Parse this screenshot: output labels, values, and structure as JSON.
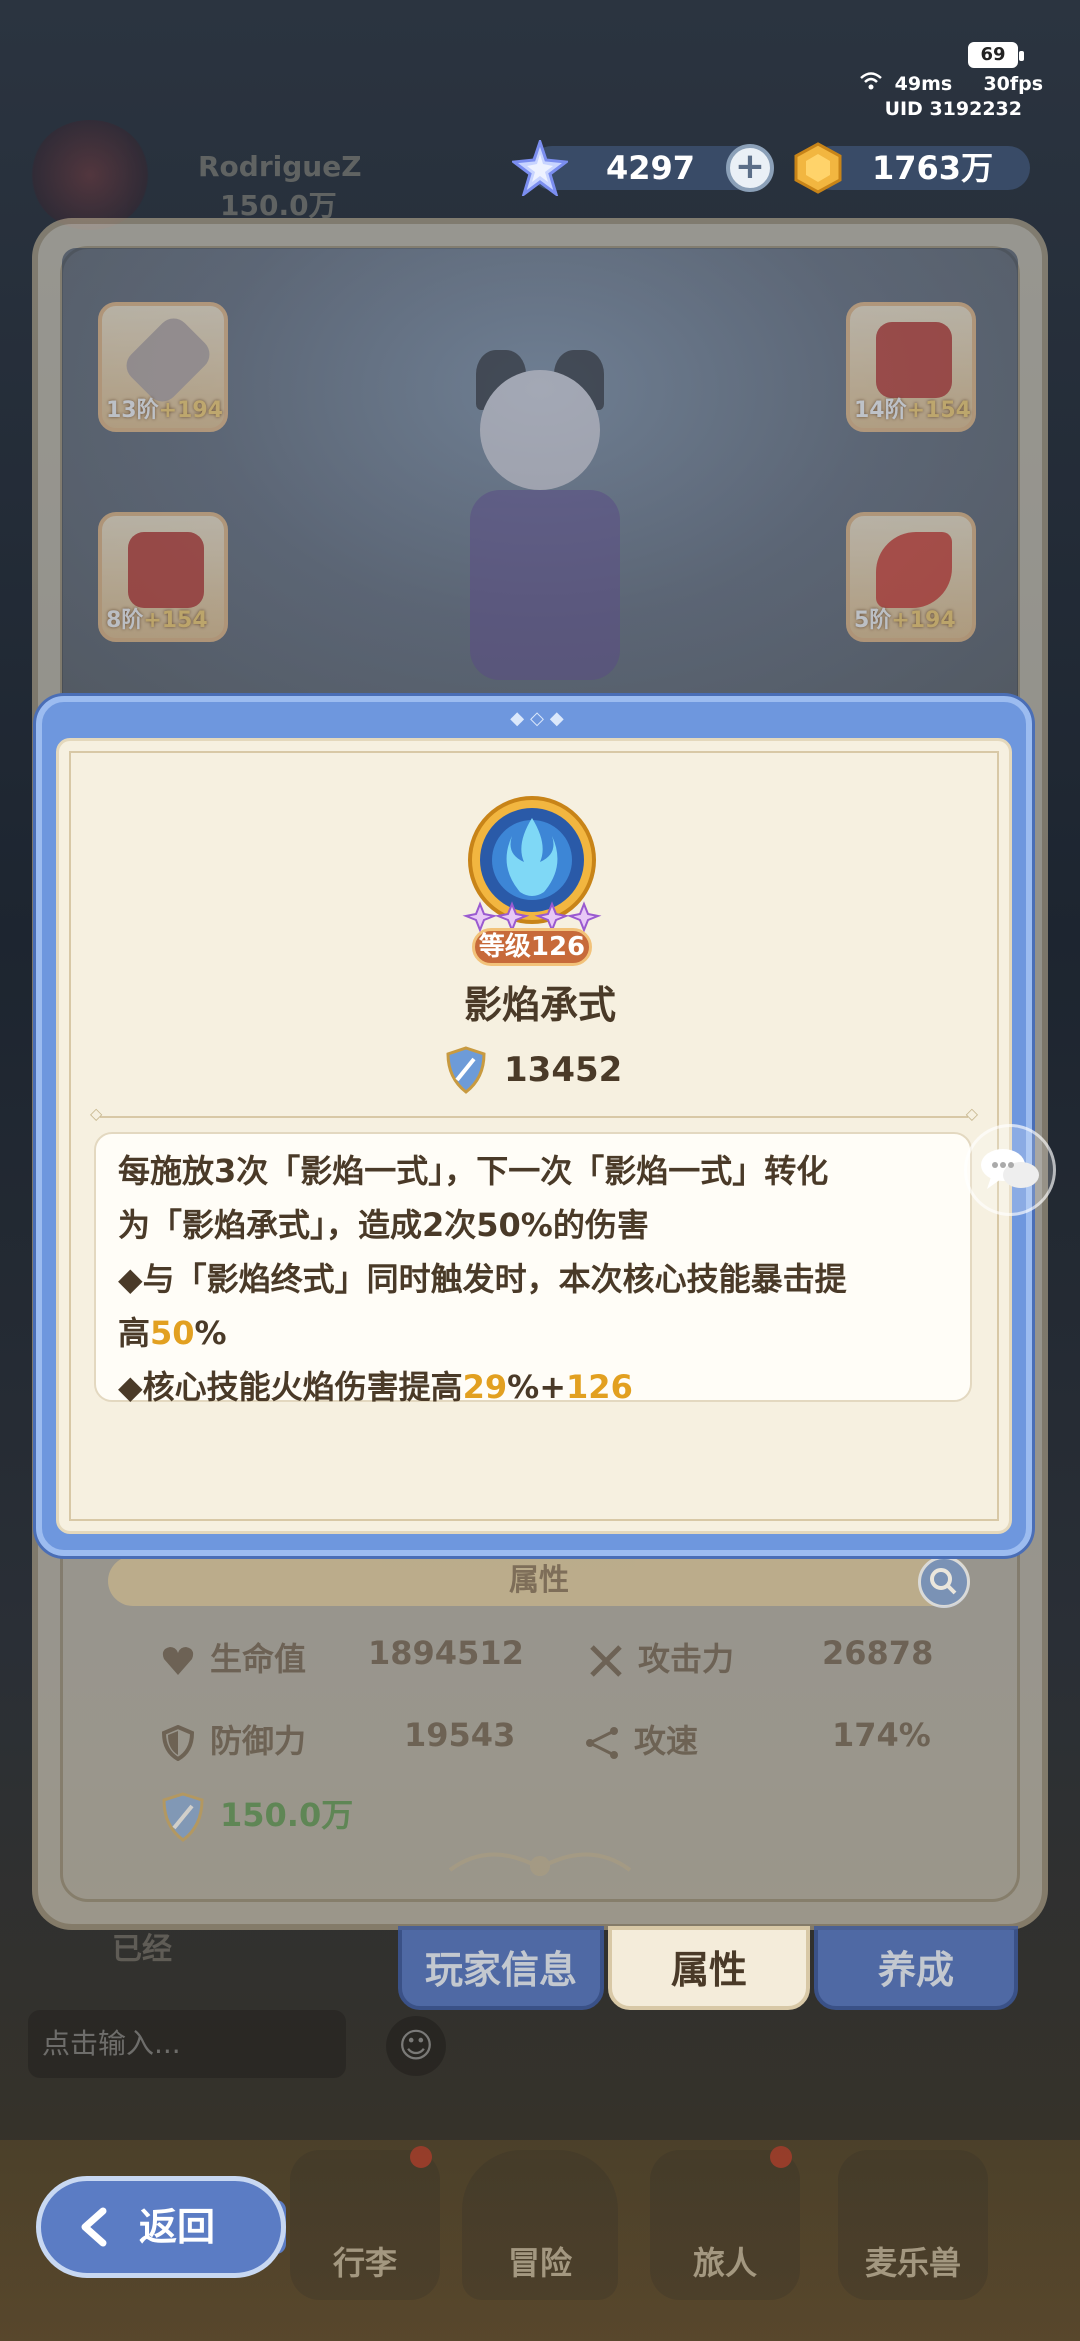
{
  "status": {
    "battery": "69",
    "ping": "49ms",
    "fps": "30fps",
    "uid": "UID 3192232"
  },
  "player": {
    "name": "RodrigueZ",
    "power": "150.0万"
  },
  "resources": {
    "stars": "4297",
    "gold": "1763万"
  },
  "equipment": [
    {
      "tier": "13阶",
      "bonus": "+194"
    },
    {
      "tier": "14阶",
      "bonus": "+154"
    },
    {
      "tier": "8阶",
      "bonus": "+154"
    },
    {
      "tier": "5阶",
      "bonus": "+194"
    }
  ],
  "skill": {
    "level": "等级126",
    "name": "影焰承式",
    "score": "13452",
    "description": {
      "l1": "每施放3次「影焰一式」，下一次「影焰一式」转化",
      "l2": "为「影焰承式」，造成2次50%的伤害",
      "l3": "◆与「影焰终式」同时触发时，本次核心技能暴击提",
      "l4_pre": "高",
      "l4_hl": "50",
      "l4_post": "%",
      "l5_pre": "◆核心技能火焰伤害提高",
      "l5_hl1": "29",
      "l5_mid": "%+",
      "l5_hl2": "126"
    }
  },
  "attributes": {
    "title": "属性",
    "hp_label": "生命值",
    "hp_value": "1894512",
    "atk_label": "攻击力",
    "atk_value": "26878",
    "def_label": "防御力",
    "def_value": "19543",
    "spd_label": "攻速",
    "spd_value": "174%",
    "power": "150.0万"
  },
  "tabs": {
    "info": "玩家信息",
    "attr": "属性",
    "train": "养成"
  },
  "background": {
    "already": "已经",
    "input_placeholder": "点击输入..."
  },
  "nav": {
    "back": "返回",
    "bag": "行李",
    "adventure": "冒险",
    "traveler": "旅人",
    "pet": "麦乐兽"
  },
  "colors": {
    "modal_blue": "#6e97de",
    "paper": "#f6f0e0",
    "highlight": "#e2a020",
    "power_green": "#2f7a2a"
  }
}
